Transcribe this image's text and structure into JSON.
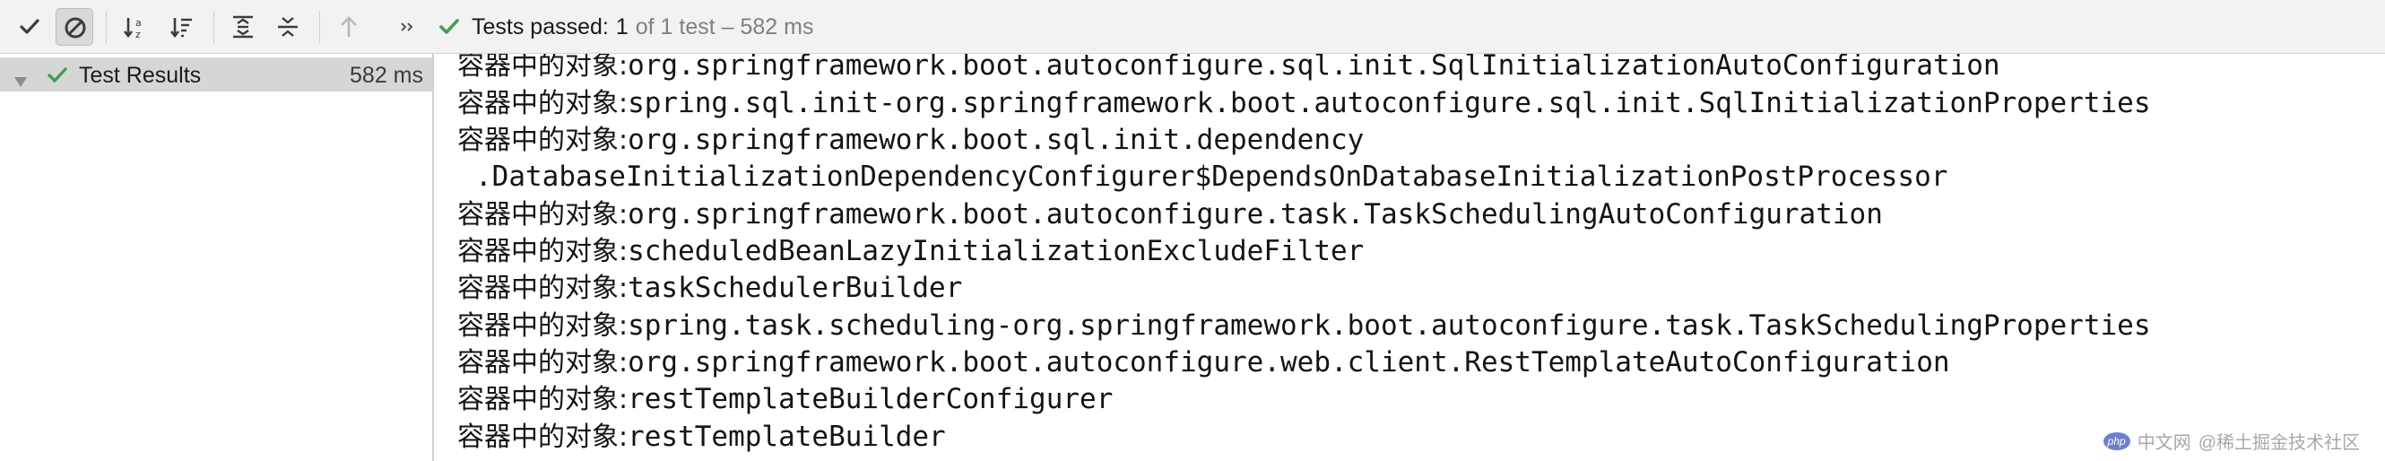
{
  "toolbar": {
    "icons": [
      "check-icon",
      "cancel-icon",
      "sort-alpha-icon",
      "sort-duration-icon",
      "expand-all-icon",
      "collapse-all-icon",
      "up-arrow-icon",
      "more-icon"
    ],
    "status": {
      "label": "Tests passed:",
      "count": "1",
      "detail": "of 1 test – 582 ms"
    }
  },
  "tree": {
    "root": {
      "label": "Test Results",
      "duration": "582 ms"
    }
  },
  "console": {
    "lines": [
      {
        "prefix": "容器中的对象:",
        "text": "org.springframework.boot.autoconfigure.sql.init.SqlInitializationAutoConfiguration"
      },
      {
        "prefix": "容器中的对象:",
        "text": "spring.sql.init-org.springframework.boot.autoconfigure.sql.init.SqlInitializationProperties"
      },
      {
        "prefix": "容器中的对象:",
        "text": "org.springframework.boot.sql.init.dependency"
      },
      {
        "prefix": "",
        "text": ".DatabaseInitializationDependencyConfigurer$DependsOnDatabaseInitializationPostProcessor"
      },
      {
        "prefix": "容器中的对象:",
        "text": "org.springframework.boot.autoconfigure.task.TaskSchedulingAutoConfiguration"
      },
      {
        "prefix": "容器中的对象:",
        "text": "scheduledBeanLazyInitializationExcludeFilter"
      },
      {
        "prefix": "容器中的对象:",
        "text": "taskSchedulerBuilder"
      },
      {
        "prefix": "容器中的对象:",
        "text": "spring.task.scheduling-org.springframework.boot.autoconfigure.task.TaskSchedulingProperties"
      },
      {
        "prefix": "容器中的对象:",
        "text": "org.springframework.boot.autoconfigure.web.client.RestTemplateAutoConfiguration"
      },
      {
        "prefix": "容器中的对象:",
        "text": "restTemplateBuilderConfigurer"
      },
      {
        "prefix": "容器中的对象:",
        "text": "restTemplateBuilder"
      }
    ]
  },
  "watermark": {
    "logo": "php",
    "site": "中文网",
    "text": "@稀土掘金技术社区"
  },
  "colors": {
    "pass_green": "#499c54",
    "toolbar_bg": "#f2f2f2",
    "selection_bg": "#d6d6d6",
    "muted_text": "#7f7f7f"
  }
}
